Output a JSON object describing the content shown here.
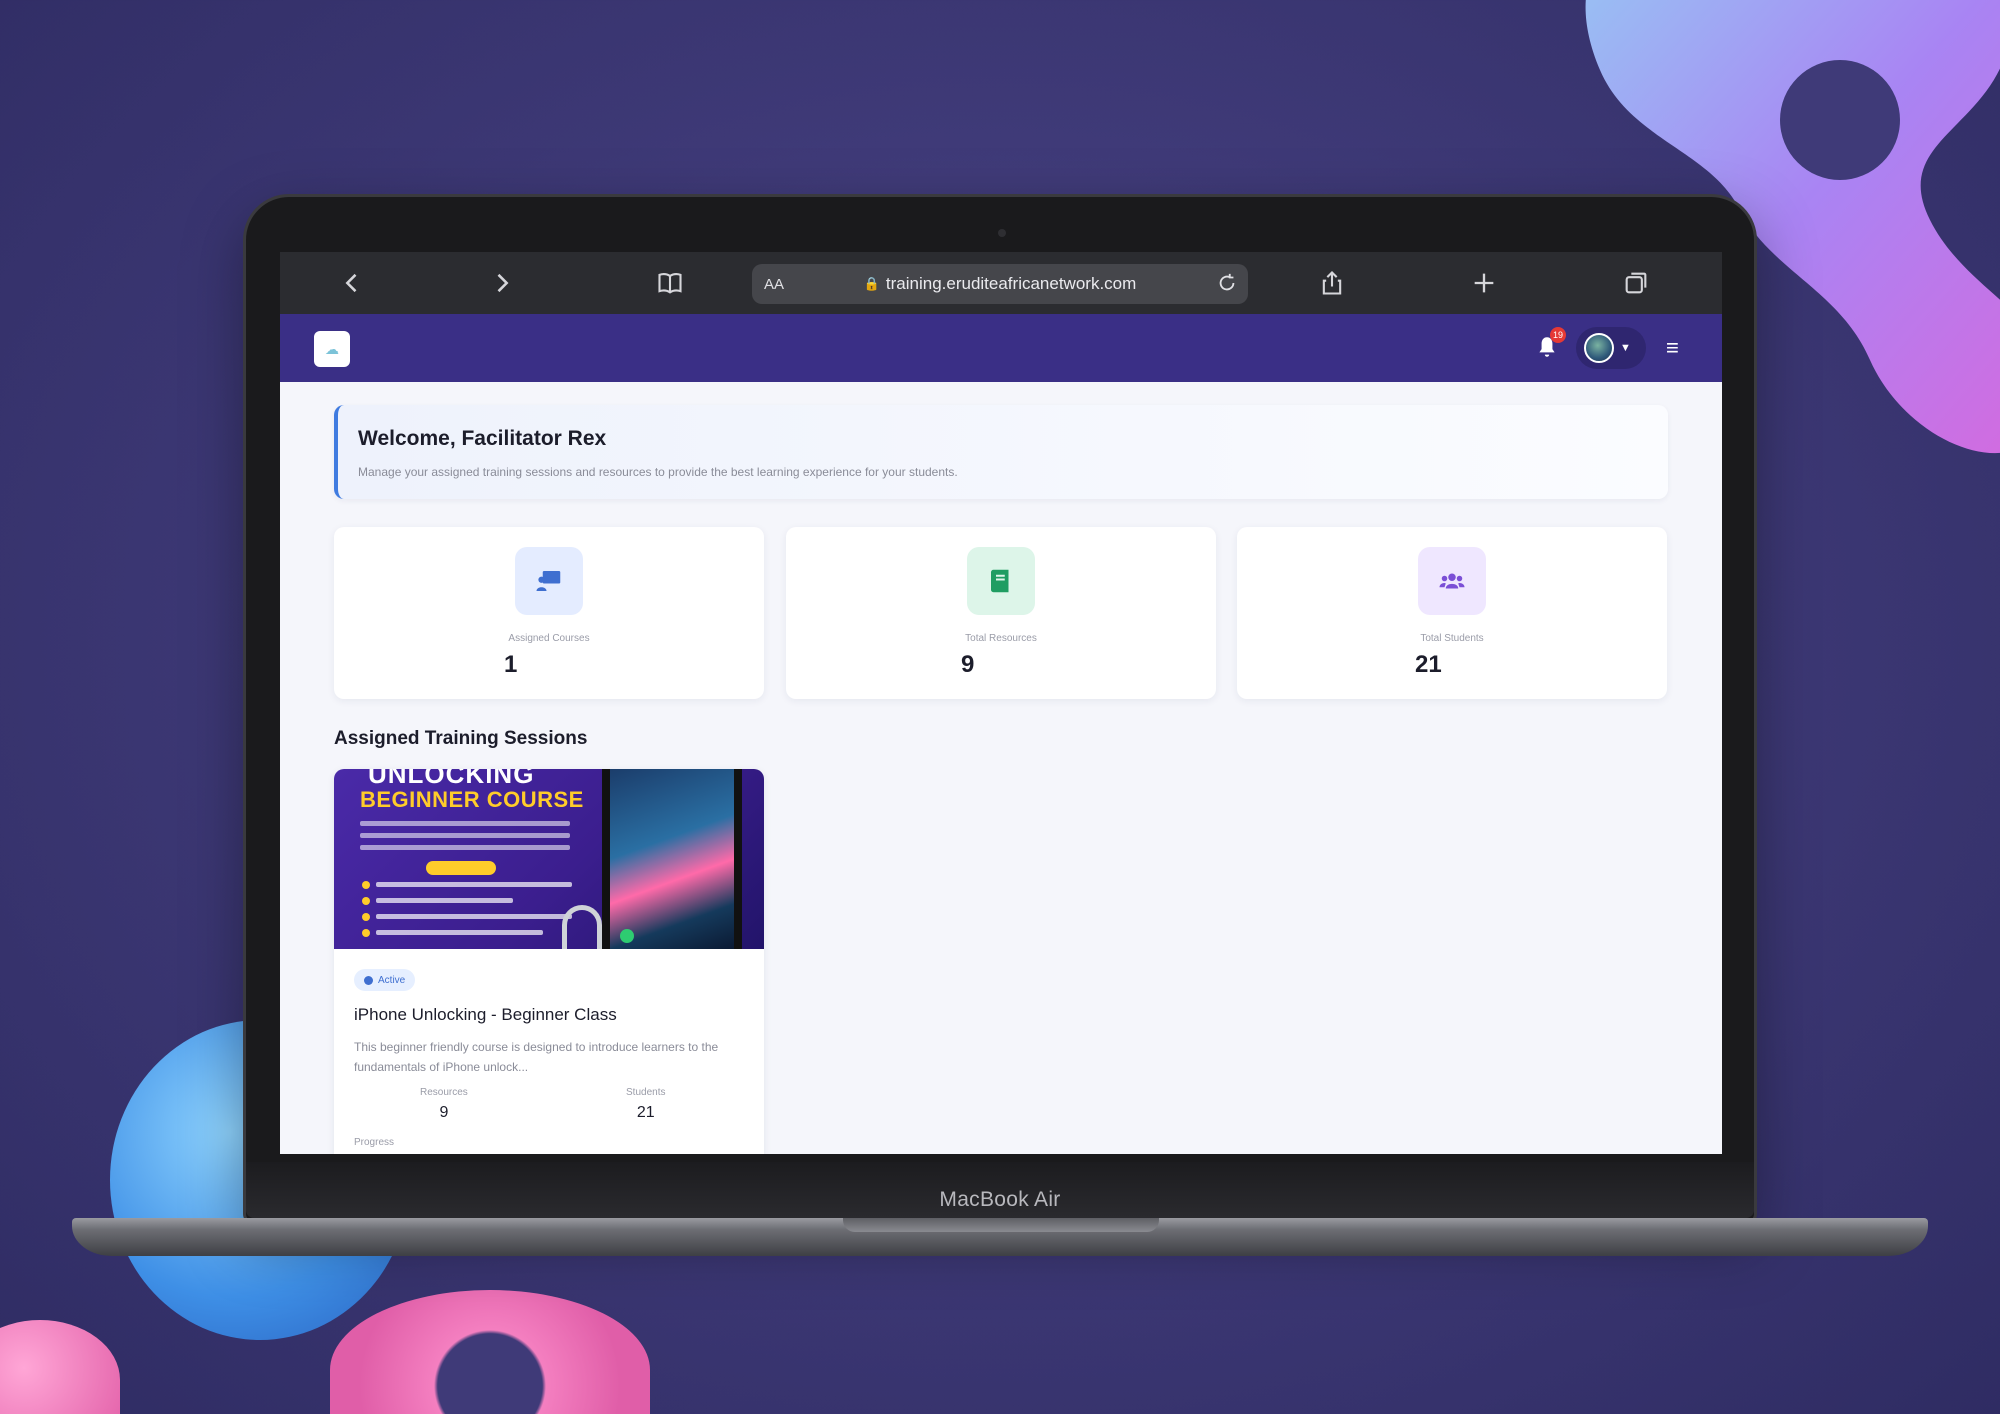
{
  "device_label": "MacBook Air",
  "browser": {
    "url": "training.eruditeafricanetwork.com",
    "text_size_label": "AA",
    "icons": [
      "chevron-left-icon",
      "chevron-right-icon",
      "book-icon",
      "lock-icon",
      "reload-icon",
      "share-icon",
      "plus-icon",
      "tabs-icon"
    ]
  },
  "header": {
    "notification_count": "19",
    "bg_color": "#3a2f86"
  },
  "welcome": {
    "title": "Welcome, Facilitator Rex",
    "subtitle": "Manage your assigned training sessions and resources to provide the best learning experience for your students."
  },
  "stats": [
    {
      "label": "Assigned Courses",
      "value": "1",
      "icon": "presentation-icon",
      "color": "#3f6fd0",
      "bg": "#e4ecff"
    },
    {
      "label": "Total Resources",
      "value": "9",
      "icon": "book-icon",
      "color": "#1f9d62",
      "bg": "#ddf5e9"
    },
    {
      "label": "Total Students",
      "value": "21",
      "icon": "users-icon",
      "color": "#7b4fd6",
      "bg": "#efe7ff"
    }
  ],
  "section_title": "Assigned Training Sessions",
  "course": {
    "banner_top": "UNLOCKING",
    "banner_main": "BEGINNER COURSE",
    "status": "Active",
    "title": "iPhone Unlocking - Beginner Class",
    "description": "This beginner friendly course is designed to introduce learners to the fundamentals of iPhone unlock...",
    "resources_label": "Resources",
    "resources_value": "9",
    "students_label": "Students",
    "students_value": "21",
    "progress_label": "Progress"
  }
}
